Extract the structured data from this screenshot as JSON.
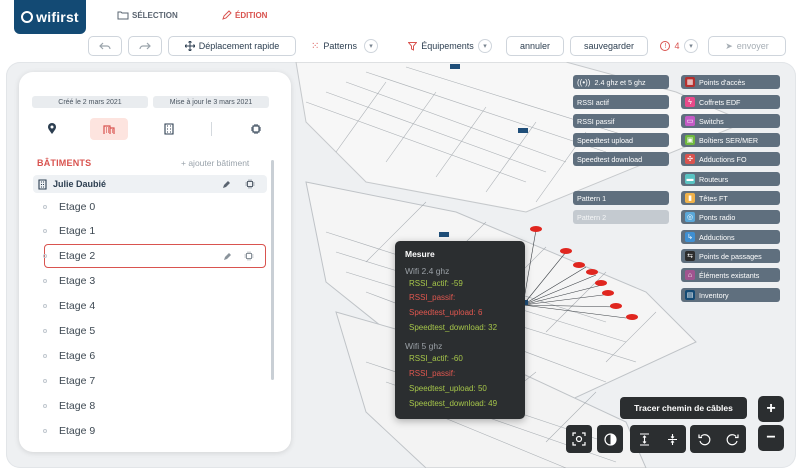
{
  "app": {
    "logo_text": "wifirst"
  },
  "modes": {
    "selection": "SÉLECTION",
    "edition": "ÉDITION"
  },
  "toolbar": {
    "move_label": "Déplacement rapide",
    "patterns_label": "Patterns",
    "equipments_label": "Équipements",
    "cancel_label": "annuler",
    "save_label": "sauvegarder",
    "alerts_count": "4",
    "send_label": "envoyer"
  },
  "panel": {
    "created": "Créé le 2 mars 2021",
    "updated": "Mise à jour le 3 mars 2021",
    "section_title": "BÂTIMENTS",
    "add_building": "+ ajouter bâtiment",
    "building_name": "Julie Daubié",
    "floors": [
      "Etage 0",
      "Etage 1",
      "Etage 2",
      "Etage 3",
      "Etage 4",
      "Etage 5",
      "Etage 6",
      "Etage 7",
      "Etage 8",
      "Etage 9"
    ],
    "selected_floor": "Etage 2"
  },
  "legend_left": {
    "items": [
      "2.4 ghz et 5 ghz",
      "RSSI actif",
      "RSSI passif",
      "Speedtest upload",
      "Speedtest download"
    ],
    "patterns": [
      "Pattern 1",
      "Pattern 2"
    ]
  },
  "legend_right": {
    "items": [
      {
        "label": "Points d'accès",
        "color": "#b5302f",
        "icon": "access-point-icon"
      },
      {
        "label": "Coffrets EDF",
        "color": "#e84a8a",
        "icon": "lightning-icon"
      },
      {
        "label": "Switchs",
        "color": "#c45bc5",
        "icon": "switch-icon"
      },
      {
        "label": "Boîtiers SER/MER",
        "color": "#6fb83f",
        "icon": "box-icon"
      },
      {
        "label": "Adductions FO",
        "color": "#d9534f",
        "icon": "fiber-icon"
      },
      {
        "label": "Routeurs",
        "color": "#59c3c3",
        "icon": "router-icon"
      },
      {
        "label": "Têtes FT",
        "color": "#f0b24a",
        "icon": "head-icon"
      },
      {
        "label": "Ponts radio",
        "color": "#5aa7d8",
        "icon": "radio-icon"
      },
      {
        "label": "Adductions",
        "color": "#3f8fd1",
        "icon": "adduction-icon"
      },
      {
        "label": "Points de passages",
        "color": "#2c2c2c",
        "icon": "passage-icon"
      },
      {
        "label": "Éléments existants",
        "color": "#a0548f",
        "icon": "home-icon"
      },
      {
        "label": "Inventory",
        "color": "#134a74",
        "icon": "inventory-icon"
      }
    ]
  },
  "measure": {
    "title": "Mesure",
    "wifi24": {
      "label": "Wifi 2.4 ghz",
      "rssi_actif": "RSSI_actif: -59",
      "rssi_passif": "RSSI_passif:",
      "upload": "Speedtest_upload: 6",
      "download": "Speedtest_download: 32"
    },
    "wifi5": {
      "label": "Wifi 5 ghz",
      "rssi_actif": "RSSI_actif: -60",
      "rssi_passif": "RSSI_passif:",
      "upload": "Speedtest_upload: 50",
      "download": "Speedtest_download: 49"
    }
  },
  "controls": {
    "cable_path": "Tracer chemin de câbles",
    "zoom_in": "+",
    "zoom_out": "−"
  }
}
